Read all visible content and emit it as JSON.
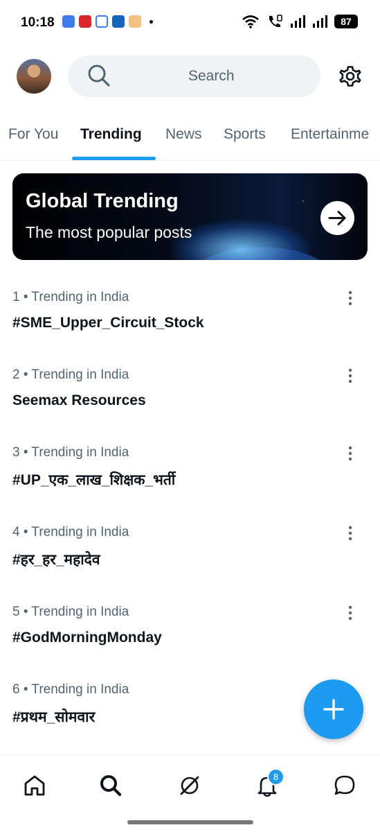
{
  "status_bar": {
    "time": "10:18",
    "battery": "87",
    "app_icons": [
      "play-app-icon",
      "red-app-icon",
      "calendar-app-icon",
      "blue-app-icon",
      "amazon-app-icon"
    ]
  },
  "header": {
    "search_placeholder": "Search"
  },
  "tabs": [
    {
      "label": "For You",
      "active": false
    },
    {
      "label": "Trending",
      "active": true
    },
    {
      "label": "News",
      "active": false
    },
    {
      "label": "Sports",
      "active": false
    },
    {
      "label": "Entertainme",
      "active": false
    }
  ],
  "banner": {
    "title": "Global Trending",
    "subtitle": "The most popular posts"
  },
  "trends": [
    {
      "meta": "1 • Trending in India",
      "title": "#SME_Upper_Circuit_Stock"
    },
    {
      "meta": "2 • Trending in India",
      "title": "Seemax Resources"
    },
    {
      "meta": "3 • Trending in India",
      "title": "#UP_एक_लाख_शिक्षक_भर्ती"
    },
    {
      "meta": "4 • Trending in India",
      "title": "#हर_हर_महादेव"
    },
    {
      "meta": "5 • Trending in India",
      "title": "#GodMorningMonday"
    },
    {
      "meta": "6 • Trending in India",
      "title": "#प्रथम_सोमवार"
    }
  ],
  "bottom_nav": {
    "notification_count": "8",
    "items": [
      "home-icon",
      "search-icon",
      "grok-icon",
      "bell-icon",
      "messages-icon"
    ]
  },
  "colors": {
    "accent": "#1d9bf0",
    "text_primary": "#0f1419",
    "text_secondary": "#536471"
  }
}
